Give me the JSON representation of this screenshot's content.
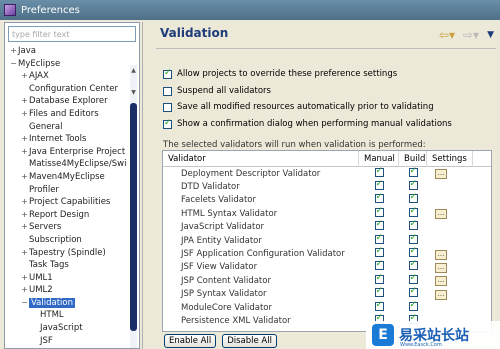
{
  "window": {
    "title": "Preferences"
  },
  "filter": {
    "placeholder": "type filter text"
  },
  "tree": [
    {
      "label": "Java",
      "depth": 0,
      "toggle": "+"
    },
    {
      "label": "MyEclipse",
      "depth": 0,
      "toggle": "−"
    },
    {
      "label": "AJAX",
      "depth": 1,
      "toggle": "+"
    },
    {
      "label": "Configuration Center",
      "depth": 1,
      "toggle": ""
    },
    {
      "label": "Database Explorer",
      "depth": 1,
      "toggle": "+"
    },
    {
      "label": "Files and Editors",
      "depth": 1,
      "toggle": "+"
    },
    {
      "label": "General",
      "depth": 1,
      "toggle": ""
    },
    {
      "label": "Internet Tools",
      "depth": 1,
      "toggle": "+"
    },
    {
      "label": "Java Enterprise Project",
      "depth": 1,
      "toggle": "+"
    },
    {
      "label": "Matisse4MyEclipse/Swi",
      "depth": 1,
      "toggle": ""
    },
    {
      "label": "Maven4MyEclipse",
      "depth": 1,
      "toggle": "+"
    },
    {
      "label": "Profiler",
      "depth": 1,
      "toggle": ""
    },
    {
      "label": "Project Capabilities",
      "depth": 1,
      "toggle": "+"
    },
    {
      "label": "Report Design",
      "depth": 1,
      "toggle": "+"
    },
    {
      "label": "Servers",
      "depth": 1,
      "toggle": "+"
    },
    {
      "label": "Subscription",
      "depth": 1,
      "toggle": ""
    },
    {
      "label": "Tapestry (Spindle)",
      "depth": 1,
      "toggle": "+"
    },
    {
      "label": "Task Tags",
      "depth": 1,
      "toggle": ""
    },
    {
      "label": "UML1",
      "depth": 1,
      "toggle": "+"
    },
    {
      "label": "UML2",
      "depth": 1,
      "toggle": "+"
    },
    {
      "label": "Validation",
      "depth": 1,
      "toggle": "−",
      "selected": true
    },
    {
      "label": "HTML",
      "depth": 2,
      "toggle": ""
    },
    {
      "label": "JavaScript",
      "depth": 2,
      "toggle": ""
    },
    {
      "label": "JSF",
      "depth": 2,
      "toggle": ""
    }
  ],
  "page": {
    "title": "Validation"
  },
  "options": [
    {
      "label": "Allow projects to override these preference settings",
      "checked": true
    },
    {
      "label": "Suspend all validators",
      "checked": false
    },
    {
      "label": "Save all modified resources automatically prior to validating",
      "checked": false
    },
    {
      "label": "Show a confirmation dialog when performing manual validations",
      "checked": true
    }
  ],
  "note": "The selected validators will run when validation is performed:",
  "table": {
    "headers": {
      "validator": "Validator",
      "manual": "Manual",
      "build": "Build",
      "settings": "Settings"
    },
    "rows": [
      {
        "name": "Deployment Descriptor Validator",
        "manual": true,
        "build": true,
        "settings": true
      },
      {
        "name": "DTD Validator",
        "manual": true,
        "build": true,
        "settings": false
      },
      {
        "name": "Facelets Validator",
        "manual": true,
        "build": true,
        "settings": false
      },
      {
        "name": "HTML Syntax Validator",
        "manual": true,
        "build": true,
        "settings": true
      },
      {
        "name": "JavaScript Validator",
        "manual": true,
        "build": true,
        "settings": false
      },
      {
        "name": "JPA Entity Validator",
        "manual": true,
        "build": true,
        "settings": false
      },
      {
        "name": "JSF Application Configuration Validator",
        "manual": true,
        "build": true,
        "settings": true
      },
      {
        "name": "JSF View Validator",
        "manual": true,
        "build": true,
        "settings": true
      },
      {
        "name": "JSP Content Validator",
        "manual": true,
        "build": true,
        "settings": true
      },
      {
        "name": "JSP Syntax Validator",
        "manual": true,
        "build": true,
        "settings": true
      },
      {
        "name": "ModuleCore Validator",
        "manual": true,
        "build": true,
        "settings": false
      },
      {
        "name": "Persistence XML Validator",
        "manual": true,
        "build": true,
        "settings": false
      }
    ]
  },
  "buttons": {
    "enable_all": "Enable All",
    "disable_all": "Disable All"
  },
  "watermark": {
    "logo": "E",
    "text": "易采站长站",
    "sub": "Www.Easck.Com"
  },
  "colors": {
    "selection": "#316ac5",
    "title_text": "#1f3c7a",
    "check": "#21a121"
  }
}
